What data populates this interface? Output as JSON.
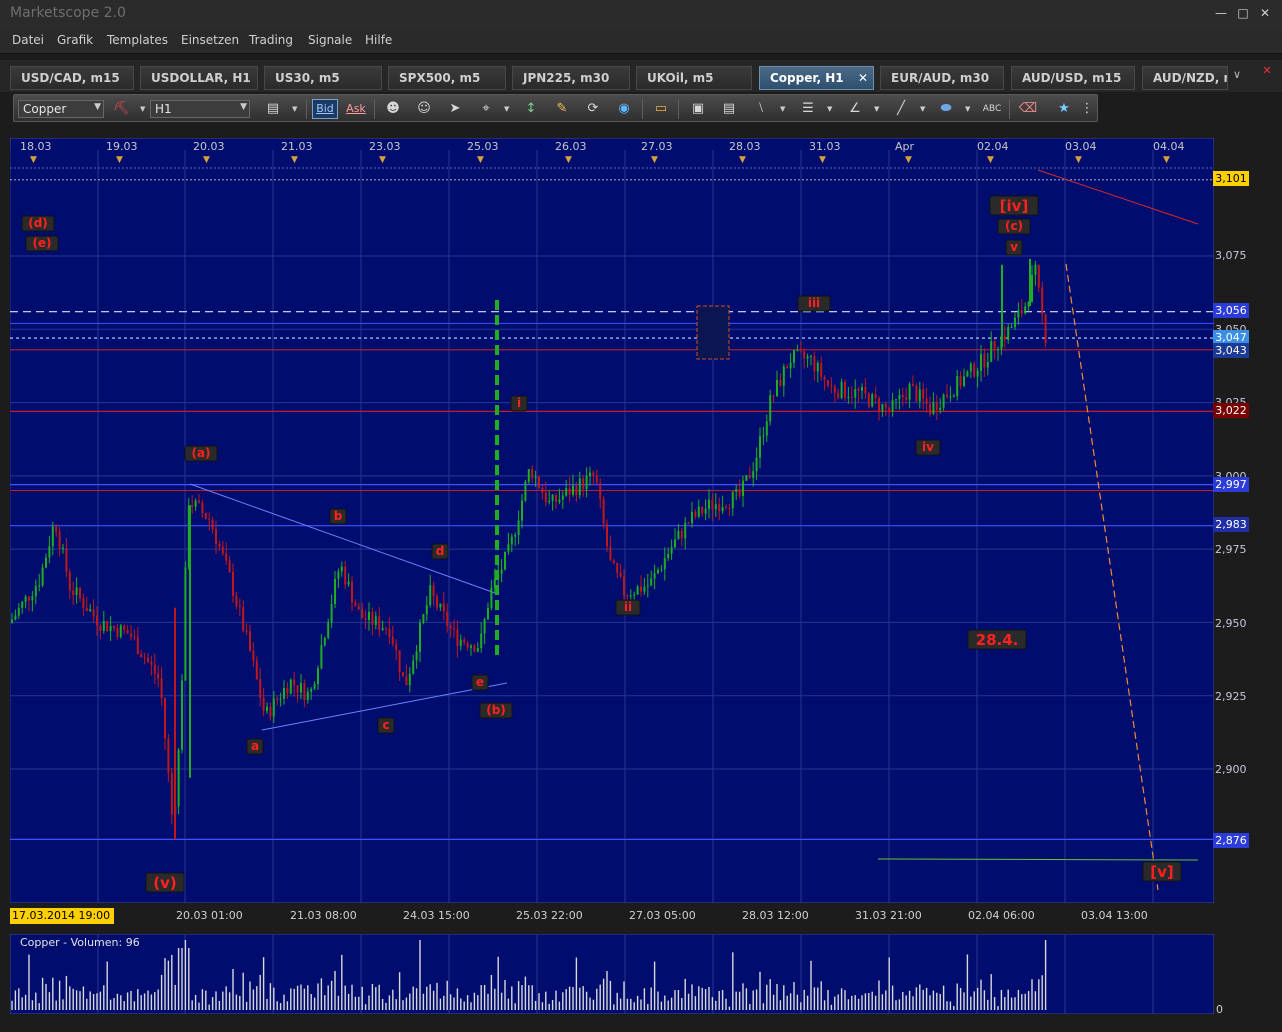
{
  "app": {
    "title": "Marketscope 2.0"
  },
  "menu": [
    "Datei",
    "Grafik",
    "Templates",
    "Einsetzen",
    "Trading",
    "Signale",
    "Hilfe"
  ],
  "tabs": [
    {
      "label": "USD/CAD, m15",
      "active": false
    },
    {
      "label": "USDOLLAR, H1",
      "active": false
    },
    {
      "label": "US30, m5",
      "active": false
    },
    {
      "label": "SPX500, m5",
      "active": false
    },
    {
      "label": "JPN225, m30",
      "active": false
    },
    {
      "label": "UKOil, m5",
      "active": false
    },
    {
      "label": "Copper, H1",
      "active": true
    },
    {
      "label": "EUR/AUD, m30",
      "active": false
    },
    {
      "label": "AUD/USD, m15",
      "active": false
    },
    {
      "label": "AUD/NZD, m",
      "active": false
    }
  ],
  "toolbar": {
    "instrument": "Copper",
    "timeframe": "H1",
    "bid_label": "Bid",
    "ask_label": "Ask",
    "icons": [
      "link-icon",
      "chart-type-icon",
      "person-icon",
      "person-2-icon",
      "cursor-icon",
      "crosshair-icon",
      "vertical-zoom-icon",
      "note-icon",
      "compass-icon",
      "globe-icon",
      "ruler-icon",
      "image-icon",
      "screenshot-icon",
      "lines-icon",
      "grid-icon",
      "fibonacci-icon",
      "pen-icon",
      "ellipse-icon",
      "abc-text-icon",
      "eraser-icon",
      "tree-icon",
      "overflow-icon"
    ]
  },
  "chart": {
    "date_axis": [
      "18.03",
      "19.03",
      "20.03",
      "21.03",
      "23.03",
      "25.03",
      "26.03",
      "27.03",
      "28.03",
      "31.03",
      "Apr",
      "02.04",
      "03.04",
      "04.04"
    ],
    "time_axis": [
      "20.03 01:00",
      "21.03 08:00",
      "24.03 15:00",
      "25.03 22:00",
      "27.03 05:00",
      "28.03 12:00",
      "31.03 21:00",
      "02.04 06:00",
      "03.04 13:00"
    ],
    "cursor_date": "17.03.2014 19:00",
    "price_ticks": [
      "3,075",
      "3,050",
      "3,025",
      "3,000",
      "2,975",
      "2,950",
      "2,925",
      "2,900"
    ],
    "price_boxes": [
      {
        "label": "3,101",
        "color": "#ffd000",
        "text": "#000000"
      },
      {
        "label": "3,056",
        "color": "#2c3cd8",
        "text": "#ffffff"
      },
      {
        "label": "3,047",
        "color": "#3b8ee6",
        "text": "#ffffff"
      },
      {
        "label": "3,043",
        "color": "#1d3b95",
        "text": "#ffffff"
      },
      {
        "label": "3,022",
        "color": "#7a0000",
        "text": "#ffffff"
      },
      {
        "label": "2,997",
        "color": "#2c3cd8",
        "text": "#ffffff"
      },
      {
        "label": "2,983",
        "color": "#1f2fa6",
        "text": "#ffffff"
      },
      {
        "label": "2,876",
        "color": "#2c3cd8",
        "text": "#ffffff"
      }
    ],
    "wave_labels": [
      "(d)",
      "(e)",
      "(a)",
      "b",
      "d",
      "(b)",
      "e",
      "a",
      "c",
      "(v)",
      "i",
      "ii",
      "iii",
      "iv",
      "[iv]",
      "(c)",
      "v",
      "28.4.",
      "[v]"
    ],
    "colors": {
      "background": "#000d6e",
      "bull": "#1fae1f",
      "bear": "#c01818",
      "label_bg": "#2a2a2a",
      "label_fg": "#ff2020"
    }
  },
  "chart_data": {
    "type": "candlestick",
    "instrument": "Copper",
    "timeframe": "H1",
    "horizontal_levels": [
      3.101,
      3.056,
      3.047,
      3.043,
      3.022,
      2.997,
      2.983,
      2.876
    ],
    "ylim": [
      2.86,
      3.105
    ],
    "grid": true
  },
  "volume": {
    "title": "Copper - Volumen: 96",
    "zero": "0"
  }
}
